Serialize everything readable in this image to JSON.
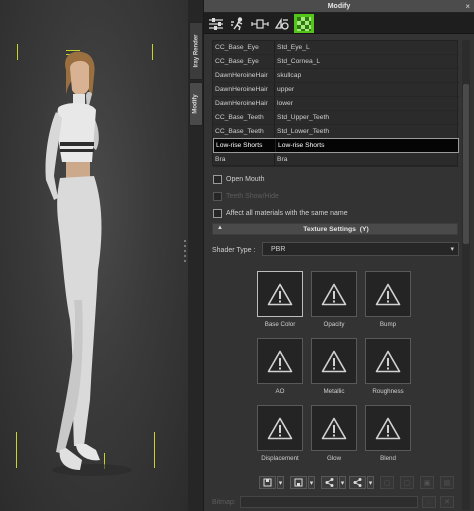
{
  "side_tabs": [
    "Iray Render",
    "Modify"
  ],
  "panel": {
    "title": "Modify",
    "close": "×",
    "toolbar": [
      "sliders-icon",
      "motion-icon",
      "transform-icon",
      "morph-icon",
      "material-icon"
    ]
  },
  "material_table": {
    "rows": [
      {
        "object": "CC_Base_Eye",
        "material": "Std_Eye_L"
      },
      {
        "object": "CC_Base_Eye",
        "material": "Std_Cornea_L"
      },
      {
        "object": "DawnHeroineHair",
        "material": "skullcap"
      },
      {
        "object": "DawnHeroineHair",
        "material": "upper"
      },
      {
        "object": "DawnHeroineHair",
        "material": "lower"
      },
      {
        "object": "CC_Base_Teeth",
        "material": "Std_Upper_Teeth"
      },
      {
        "object": "CC_Base_Teeth",
        "material": "Std_Lower_Teeth"
      },
      {
        "object": "Low-rise Shorts",
        "material": "Low-rise Shorts"
      },
      {
        "object": "Bra",
        "material": "Bra"
      }
    ],
    "selected_index": 7
  },
  "options": {
    "open_mouth": "Open Mouth",
    "teeth_show_hide": "Teeth Show/Hide",
    "affect_all": "Affect all materials with the same name"
  },
  "texture_settings": {
    "header": "Texture Settings",
    "shortcut": "(Y)",
    "shader_label": "Shader Type :",
    "shader_value": "PBR",
    "slots": [
      "Base Color",
      "Opacity",
      "Bump",
      "AO",
      "Metallic",
      "Roughness",
      "Displacement",
      "Glow",
      "Blend"
    ],
    "selected_slot": 0
  },
  "bitmap_label": "Bitmap:",
  "colors": {
    "accent": "#54c51b",
    "bracket": "#c8d22a",
    "warning_icon": "#d2d2d2"
  }
}
